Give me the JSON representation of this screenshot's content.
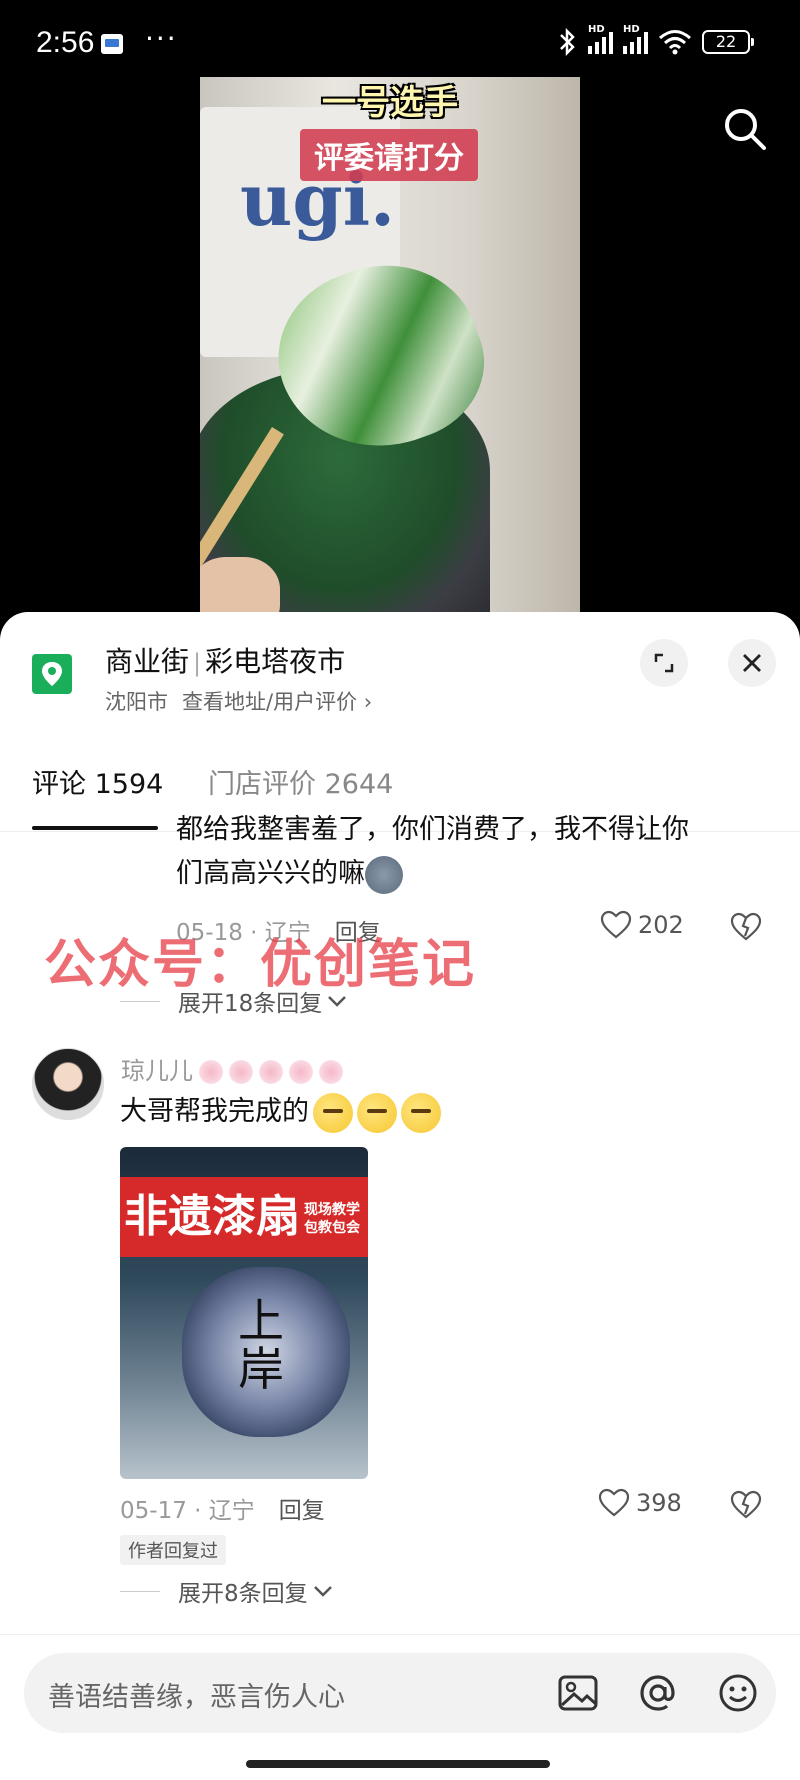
{
  "status_bar": {
    "time": "2:56",
    "battery": "22"
  },
  "video": {
    "caption_top": "一号选手",
    "caption_main": "评委请打分",
    "bag_text": "ugi."
  },
  "location": {
    "name": "商业街",
    "place": "彩电塔夜市",
    "city": "沈阳市",
    "link": "查看地址/用户评价 ›"
  },
  "tabs": [
    {
      "label": "评论 1594"
    },
    {
      "label": "门店评价 2644"
    }
  ],
  "comment1": {
    "text_line1": "都给我整害羞了，你们消费了，我不得让你",
    "text_line2": "们高高兴兴的嘛",
    "date_region": "05-18 · 辽宁",
    "reply": "回复",
    "likes": "202",
    "expand": "展开18条回复"
  },
  "watermark": "公众号：优创笔记",
  "comment2": {
    "username": "琼儿儿",
    "text": "大哥帮我完成的",
    "photo_banner": "非遗漆扇",
    "photo_banner_small1": "现场教学",
    "photo_banner_small2": "包教包会",
    "photo_ink": "上岸",
    "date_region": "05-17 · 辽宁",
    "reply": "回复",
    "likes": "398",
    "author_tag": "作者回复过",
    "expand": "展开8条回复"
  },
  "composer": {
    "placeholder": "善语结善缘，恶言伤人心"
  },
  "colors": {
    "accent_green": "#1aad5a",
    "watermark_red": "#e63c46"
  }
}
